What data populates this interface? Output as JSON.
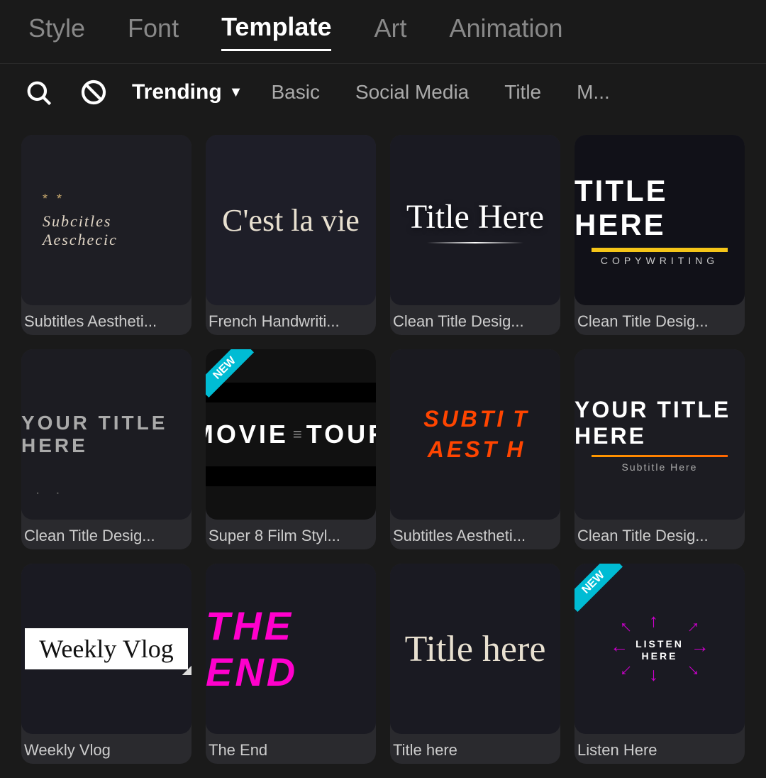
{
  "topNav": {
    "tabs": [
      {
        "id": "style",
        "label": "Style",
        "active": false
      },
      {
        "id": "font",
        "label": "Font",
        "active": false
      },
      {
        "id": "template",
        "label": "Template",
        "active": true
      },
      {
        "id": "art",
        "label": "Art",
        "active": false
      },
      {
        "id": "animation",
        "label": "Animation",
        "active": false
      }
    ]
  },
  "filterBar": {
    "searchPlaceholder": "Search",
    "filters": [
      {
        "id": "trending",
        "label": "Trending",
        "active": true,
        "hasDropdown": true
      },
      {
        "id": "basic",
        "label": "Basic",
        "active": false
      },
      {
        "id": "social-media",
        "label": "Social Media",
        "active": false
      },
      {
        "id": "title",
        "label": "Title",
        "active": false
      },
      {
        "id": "more",
        "label": "M...",
        "active": false
      }
    ]
  },
  "templates": [
    {
      "id": "subtitles-aesthetic-1",
      "label": "Subtitles Aestheti...",
      "type": "subtitles-aesthetic",
      "isNew": false,
      "titleText": "Subcitles Aeschecic"
    },
    {
      "id": "french-handwriting",
      "label": "French Handwriti...",
      "type": "french",
      "isNew": false,
      "titleText": "C'est la vie"
    },
    {
      "id": "clean-title-script",
      "label": "Clean Title Desig...",
      "type": "clean-script",
      "isNew": false,
      "titleText": "Title Here"
    },
    {
      "id": "clean-title-bold",
      "label": "Clean Title Desig...",
      "type": "clean-bold",
      "isNew": false,
      "titleText": "TITLE HERE",
      "subText": "COPYWRITING"
    },
    {
      "id": "your-title-minimal",
      "label": "Clean Title Desig...",
      "type": "your-title-min",
      "isNew": false,
      "titleText": "YOUR TITLE HERE"
    },
    {
      "id": "movie-tour",
      "label": "Super 8 Film Styl...",
      "type": "movie-tour",
      "isNew": true,
      "titleText": "MOVIE TOUR"
    },
    {
      "id": "subtitles-aesthetic-2",
      "label": "Subtitles Aestheti...",
      "type": "subtitles-aest2",
      "isNew": false,
      "mainText1": "SUBTI",
      "letter1": "T",
      "mainText2": "AEST",
      "letter2": "H"
    },
    {
      "id": "clean-title-underline",
      "label": "Clean Title Desig...",
      "type": "clean-underline",
      "isNew": false,
      "titleText": "YOUR TITLE HERE",
      "subText": "Subtitle Here"
    },
    {
      "id": "weekly-vlog",
      "label": "Weekly Vlog",
      "type": "weekly-vlog",
      "isNew": false,
      "titleText": "Weekly Vlog"
    },
    {
      "id": "the-end",
      "label": "The End",
      "type": "the-end",
      "isNew": false,
      "titleText": "THE END"
    },
    {
      "id": "title-here-script",
      "label": "Title here",
      "type": "title-here-script",
      "isNew": false,
      "titleText": "Title here"
    },
    {
      "id": "listen-here",
      "label": "Listen Here",
      "type": "listen-here",
      "isNew": true,
      "titleText": "LISTEN HERE"
    }
  ]
}
